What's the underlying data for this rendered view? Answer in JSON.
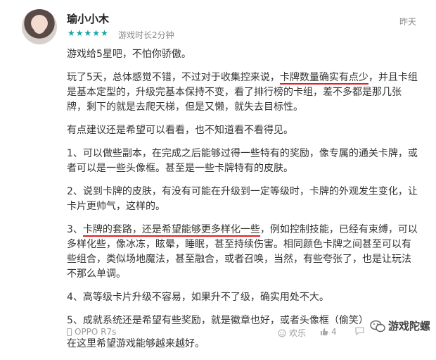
{
  "header": {
    "username": "瑜小小木",
    "stars": [
      "★",
      "★",
      "★",
      "★",
      "★"
    ],
    "playtime": "游戏时长2分钟",
    "time_ago": "昨天"
  },
  "review": {
    "p1": "游戏给5星吧，不怕你骄傲。",
    "p2_a": "玩了5天，总体感觉不错，不过对于收集控来说，",
    "p2_u": "卡牌数量确实有点少",
    "p2_b": "，并且卡组是基本定型的，升级完基本保持不变，看了排行榜的卡组，差不多都是那几张牌，剩下的就是去爬天梯，但是又懒，就失去目标性。",
    "p3": "有点建议还是希望可以看看，也不知道看不看得见。",
    "p4": "1、可以做些副本，在完成之后能够过得一些特有的奖励，像专属的通关卡牌，或者可以是一些头像框。甚至是一些卡牌特有的皮肤。",
    "p5": "2、说到卡牌的皮肤，有没有可能在升级到一定等级时，卡牌的外观发生变化，让卡片更帅气，这样的。",
    "p6_pre": "3、",
    "p6_u": "卡牌的套路，还是希望能够更多样化一些",
    "p6_b": "，例如控制技能，已经有束缚，可以多样化些，像冰冻，眩晕，睡眠，甚至持续伤害。相同颜色卡牌之间甚至可以有些组合，类似场地魔法，甚至融合，或者召唤，当然，有些夸张了，也是让玩法不那么单调。",
    "p7": "4、高等级卡片升级不容易，如果升不了级，确实用处不大。",
    "p8": "5、成就系统还是希望有些奖励，就是徽章也好，或者头像框（偷笑）",
    "p9": "在这里希望游戏能够越来越好。"
  },
  "footer": {
    "device": "OPPO R7s",
    "fun_label": "欢乐",
    "like_count": "4"
  },
  "watermark": {
    "text": "游戏陀螺"
  },
  "colors": {
    "star": "#1aa3a3",
    "underline": "#e02020"
  }
}
